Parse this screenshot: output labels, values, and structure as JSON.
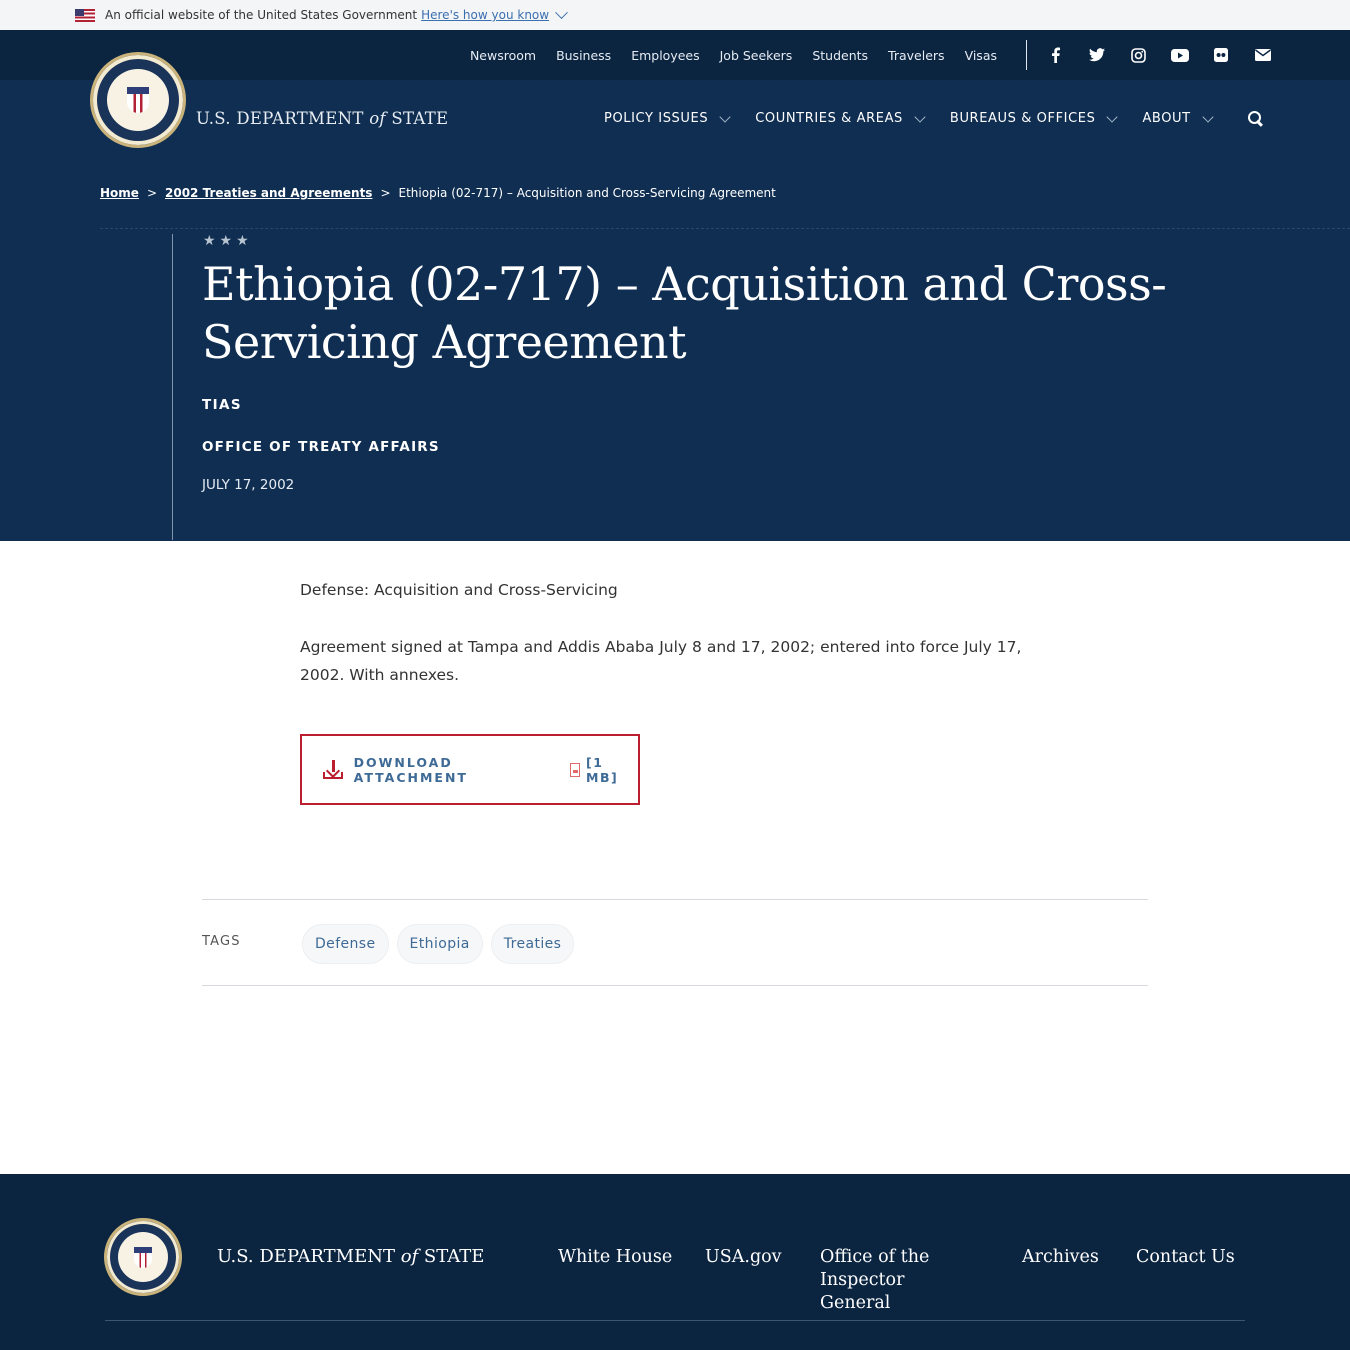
{
  "gov_banner": {
    "text": "An official website of the United States Government",
    "link": "Here's how you know"
  },
  "utility_nav": [
    "Newsroom",
    "Business",
    "Employees",
    "Job Seekers",
    "Students",
    "Travelers",
    "Visas"
  ],
  "social_icons": [
    "facebook-icon",
    "twitter-icon",
    "instagram-icon",
    "youtube-icon",
    "flickr-icon",
    "email-icon"
  ],
  "brand": {
    "pre": "U.S. DEPARTMENT ",
    "of": "of",
    "post": " STATE"
  },
  "main_nav": [
    "POLICY ISSUES",
    "COUNTRIES & AREAS",
    "BUREAUS & OFFICES",
    "ABOUT"
  ],
  "breadcrumb": {
    "home": "Home",
    "parent": "2002 Treaties and Agreements",
    "current": "Ethiopia (02-717) – Acquisition and Cross-Servicing Agreement",
    "sep": ">"
  },
  "hero": {
    "stars": "★★★",
    "title": "Ethiopia (02-717) – Acquisition and Cross-Servicing Agreement",
    "tag_line": "TIAS",
    "office": "OFFICE OF TREATY AFFAIRS",
    "date": "JULY 17, 2002"
  },
  "content": {
    "line1": "Defense: Acquisition and Cross-Servicing",
    "line2": "Agreement signed at Tampa and Addis Ababa July 8 and 17, 2002; entered into force July 17, 2002. With annexes."
  },
  "download": {
    "label": "DOWNLOAD ATTACHMENT",
    "size": "[1 MB]"
  },
  "tags": {
    "label": "TAGS",
    "items": [
      "Defense",
      "Ethiopia",
      "Treaties"
    ]
  },
  "footer": {
    "links": [
      "White House",
      "USA.gov",
      "Office of the Inspector General",
      "Archives",
      "Contact Us"
    ]
  },
  "colors": {
    "navy": "#0f2e51",
    "dark_navy": "#0b2440",
    "accent_red": "#bb1f2f",
    "link_blue": "#3e6a96"
  }
}
